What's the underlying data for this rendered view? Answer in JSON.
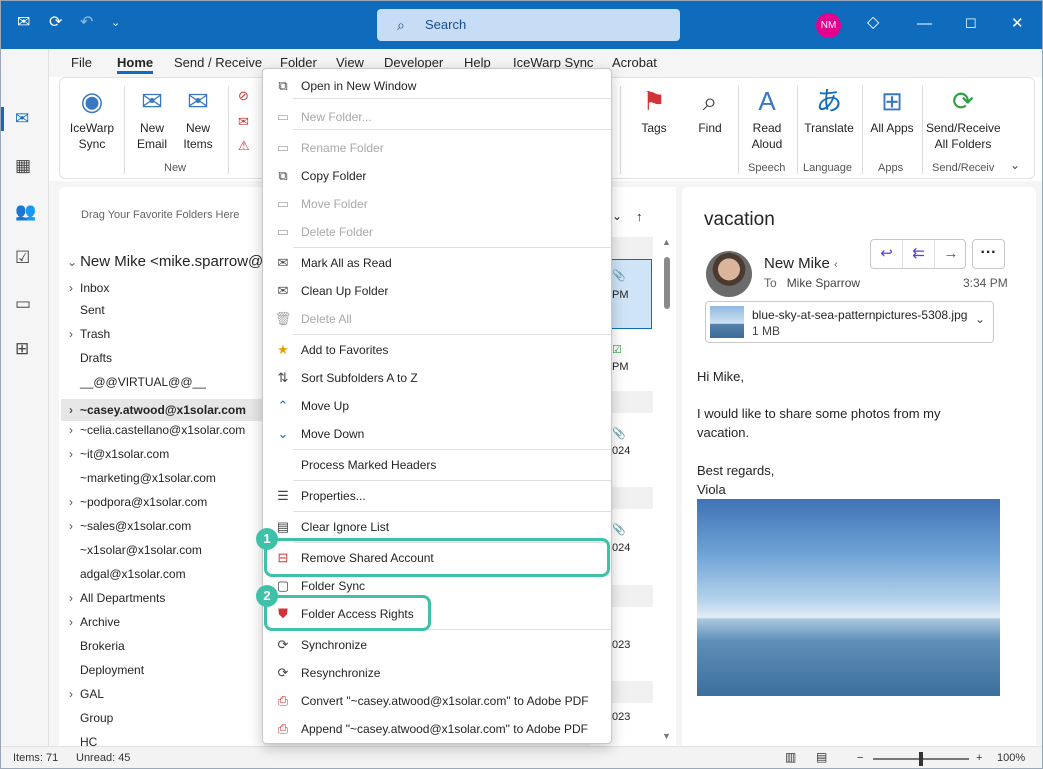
{
  "titlebar": {
    "search_placeholder": "Search",
    "user_initials": "NM",
    "accent": "#0f6cbd"
  },
  "menu_tabs": [
    "File",
    "Home",
    "Send / Receive",
    "Folder",
    "View",
    "Developer",
    "Help",
    "IceWarp Sync",
    "Acrobat"
  ],
  "ribbon": {
    "icewarp_sync": "IceWarp Sync",
    "new_email": "New Email",
    "new_items": "New Items",
    "group_new": "New",
    "tags": "Tags",
    "find": "Find",
    "read_aloud": "Read Aloud",
    "group_speech": "Speech",
    "translate": "Translate",
    "group_language": "Language",
    "all_apps": "All Apps",
    "group_apps": "Apps",
    "send_receive_all": "Send/Receive All Folders",
    "group_send_receive": "Send/Receiv"
  },
  "folders": {
    "favorites_hint": "Drag Your Favorite Folders Here",
    "account": "New Mike <mike.sparrow@",
    "items": [
      {
        "label": "Inbox",
        "chevron": true,
        "bold": false
      },
      {
        "label": "Sent",
        "chevron": false,
        "bold": false
      },
      {
        "label": "Trash",
        "chevron": true,
        "bold": false
      },
      {
        "label": "Drafts",
        "chevron": false,
        "bold": false
      },
      {
        "label": "__@@VIRTUAL@@__",
        "chevron": false,
        "bold": false
      },
      {
        "label": "~casey.atwood@x1solar.com",
        "chevron": true,
        "bold": true
      },
      {
        "label": "~celia.castellano@x1solar.com",
        "chevron": true,
        "bold": false
      },
      {
        "label": "~it@x1solar.com",
        "chevron": true,
        "bold": false
      },
      {
        "label": "~marketing@x1solar.com",
        "chevron": false,
        "bold": false
      },
      {
        "label": "~podpora@x1solar.com",
        "chevron": true,
        "bold": false
      },
      {
        "label": "~sales@x1solar.com",
        "chevron": true,
        "bold": false
      },
      {
        "label": "~x1solar@x1solar.com",
        "chevron": false,
        "bold": false
      },
      {
        "label": "adgal@x1solar.com",
        "chevron": false,
        "bold": false
      },
      {
        "label": "All Departments",
        "chevron": true,
        "bold": false
      },
      {
        "label": "Archive",
        "chevron": true,
        "bold": false
      },
      {
        "label": "Brokeria",
        "chevron": false,
        "bold": false
      },
      {
        "label": "Deployment",
        "chevron": false,
        "bold": false
      },
      {
        "label": "GAL",
        "chevron": true,
        "bold": false
      },
      {
        "label": "Group",
        "chevron": false,
        "bold": false
      },
      {
        "label": "HC",
        "chevron": false,
        "bold": false
      }
    ]
  },
  "message_list": {
    "fragments": [
      "PM",
      "PM",
      "024",
      "024",
      "023",
      "023"
    ]
  },
  "context_menu": {
    "items": [
      {
        "label": "Open in New Window",
        "icon": "new-window-icon",
        "disabled": false
      },
      {
        "label": "New Folder...",
        "icon": "new-folder-icon",
        "disabled": true
      },
      {
        "label": "Rename Folder",
        "icon": "rename-folder-icon",
        "disabled": true
      },
      {
        "label": "Copy Folder",
        "icon": "copy-folder-icon",
        "disabled": false
      },
      {
        "label": "Move Folder",
        "icon": "move-folder-icon",
        "disabled": true
      },
      {
        "label": "Delete Folder",
        "icon": "delete-folder-icon",
        "disabled": true
      },
      {
        "label": "Mark All as Read",
        "icon": "envelope-open-icon",
        "disabled": false
      },
      {
        "label": "Clean Up Folder",
        "icon": "clean-up-icon",
        "disabled": false
      },
      {
        "label": "Delete All",
        "icon": "delete-all-icon",
        "disabled": true
      },
      {
        "label": "Add to Favorites",
        "icon": "favorite-star-icon",
        "disabled": false
      },
      {
        "label": "Sort Subfolders A to Z",
        "icon": "sort-az-icon",
        "disabled": false
      },
      {
        "label": "Move Up",
        "icon": "chevron-up-icon",
        "disabled": false
      },
      {
        "label": "Move Down",
        "icon": "chevron-down-icon",
        "disabled": false
      },
      {
        "label": "Process Marked Headers",
        "icon": "",
        "disabled": false
      },
      {
        "label": "Properties...",
        "icon": "properties-icon",
        "disabled": false
      },
      {
        "label": "Clear Ignore List",
        "icon": "clear-list-icon",
        "disabled": false
      },
      {
        "label": "Remove Shared Account",
        "icon": "remove-account-icon",
        "disabled": false
      },
      {
        "label": "Folder Sync",
        "icon": "folder-sync-icon",
        "disabled": false
      },
      {
        "label": "Folder Access Rights",
        "icon": "shield-icon",
        "disabled": false
      },
      {
        "label": "Synchronize",
        "icon": "sync-icon",
        "disabled": false
      },
      {
        "label": "Resynchronize",
        "icon": "resync-icon",
        "disabled": false
      },
      {
        "label": "Convert \"~casey.atwood@x1solar.com\" to Adobe PDF",
        "icon": "pdf-convert-icon",
        "disabled": false
      },
      {
        "label": "Append \"~casey.atwood@x1solar.com\" to Adobe PDF",
        "icon": "pdf-append-icon",
        "disabled": false
      }
    ],
    "callouts": [
      "1",
      "2"
    ],
    "callout_color": "#3fc1a8"
  },
  "reading_pane": {
    "subject": "vacation",
    "sender": "New Mike",
    "to_label": "To",
    "to_name": "Mike Sparrow",
    "time": "3:34 PM",
    "attachment_name": "blue-sky-at-sea-patternpictures-5308.jpg",
    "attachment_size": "1 MB",
    "body": [
      "Hi Mike,",
      "I would like to share some photos from my",
      "vacation.",
      "Best regards,",
      "Viola"
    ]
  },
  "status_bar": {
    "items": "Items: 71",
    "unread": "Unread: 45",
    "zoom": "100%"
  }
}
